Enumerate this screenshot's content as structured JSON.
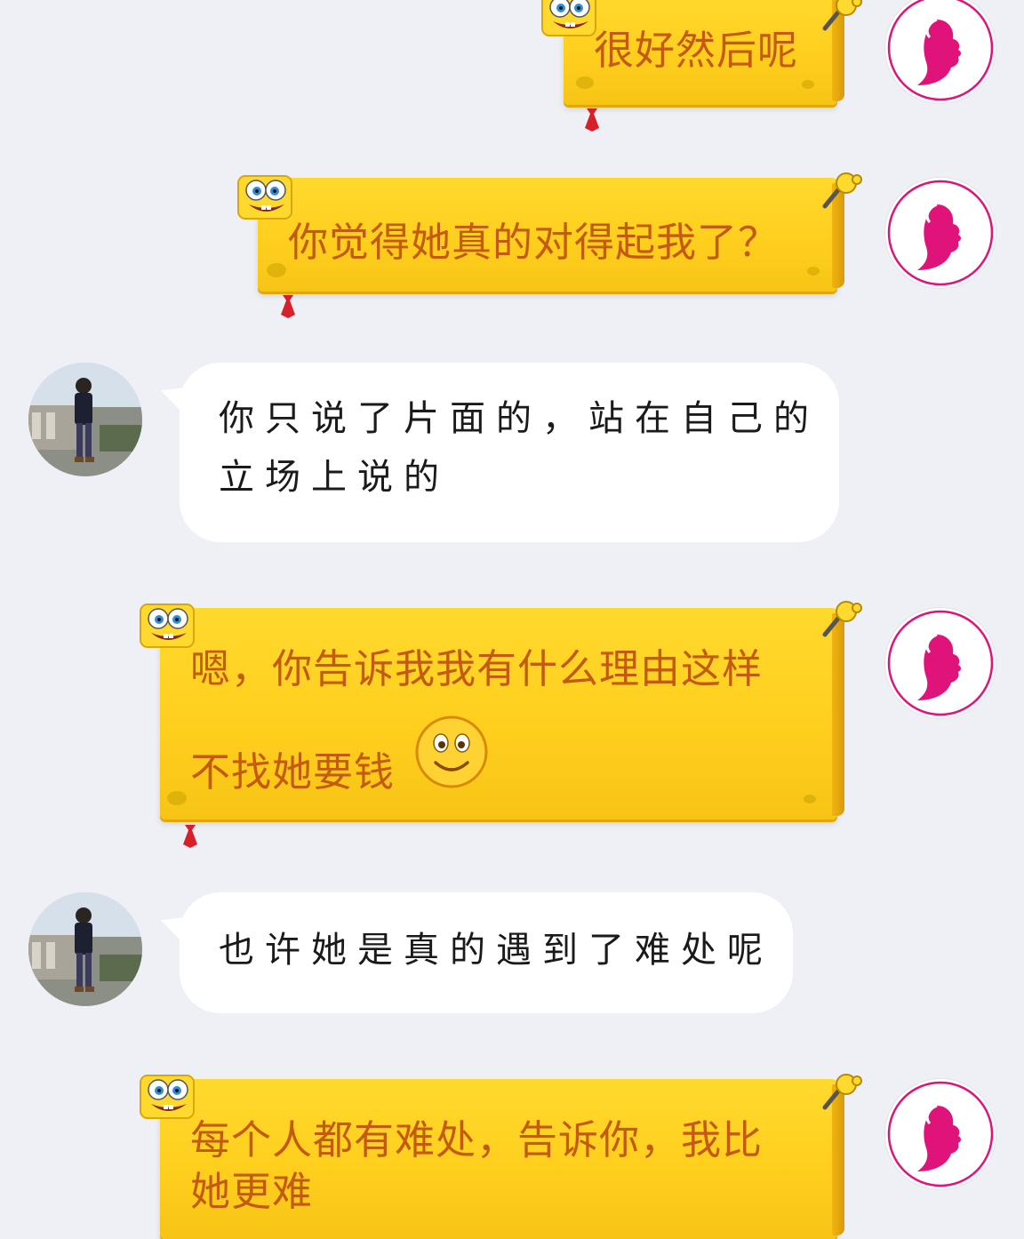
{
  "colors": {
    "page_background": "#eef0f5",
    "yellow_bubble": "#ffcf1e",
    "yellow_text": "#c45a0f",
    "white_bubble": "#ffffff",
    "white_text": "#1a1a1a",
    "avatar_logo_accent": "#e0137a"
  },
  "messages": [
    {
      "side": "right",
      "text": "很好然后呢",
      "avatar": "pink-face-logo-avatar"
    },
    {
      "side": "right",
      "text": "你觉得她真的对得起我了？",
      "avatar": "pink-face-logo-avatar"
    },
    {
      "side": "left",
      "text": "你只说了片面的，站在自己的\n立场上说的",
      "avatar": "person-photo-avatar"
    },
    {
      "side": "right",
      "text": "嗯，你告诉我我有什么理由这样\n\n不找她要钱",
      "avatar": "pink-face-logo-avatar",
      "emoji": "smile-emoji"
    },
    {
      "side": "left",
      "text": "也许她是真的遇到了难处呢",
      "avatar": "person-photo-avatar"
    },
    {
      "side": "right",
      "text": "每个人都有难处，告诉你，我比\n她更难",
      "avatar": "pink-face-logo-avatar"
    }
  ]
}
